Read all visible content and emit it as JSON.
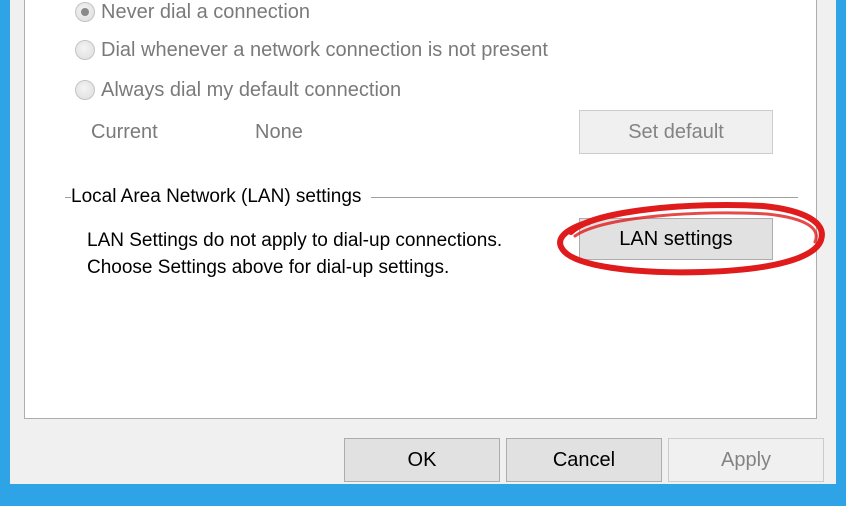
{
  "dial_options": [
    {
      "label": "Never dial a connection",
      "checked": true
    },
    {
      "label": "Dial whenever a network connection is not present",
      "checked": false
    },
    {
      "label": "Always dial my default connection",
      "checked": false
    }
  ],
  "current_row": {
    "label": "Current",
    "value": "None",
    "set_default_label": "Set default"
  },
  "lan_group": {
    "title": "Local Area Network (LAN) settings",
    "description_line1": "LAN Settings do not apply to dial-up connections.",
    "description_line2": "Choose Settings above for dial-up settings.",
    "lan_settings_label": "LAN settings"
  },
  "dialog_buttons": {
    "ok_label": "OK",
    "cancel_label": "Cancel",
    "apply_label": "Apply"
  },
  "colors": {
    "window_border": "#2ea4e6",
    "annotation": "#e01b1b"
  }
}
